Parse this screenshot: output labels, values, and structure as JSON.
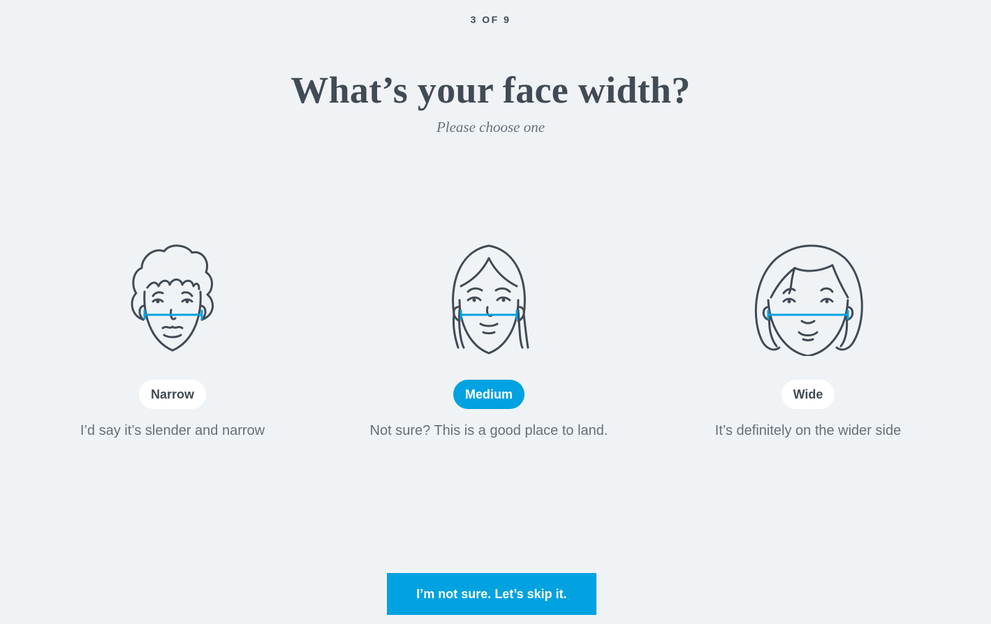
{
  "progress": {
    "label": "3 OF 9",
    "current": 3,
    "total": 9
  },
  "header": {
    "title": "What’s your face width?",
    "subtitle": "Please choose one"
  },
  "options": [
    {
      "label": "Narrow",
      "description": "I’d say it’s slender and narrow",
      "selected": false,
      "icon": "narrow-face-icon"
    },
    {
      "label": "Medium",
      "description": "Not sure? This is a good place to land.",
      "selected": true,
      "icon": "medium-face-icon"
    },
    {
      "label": "Wide",
      "description": "It’s definitely on the wider side",
      "selected": false,
      "icon": "wide-face-icon"
    }
  ],
  "skip_button": {
    "label": "I’m not sure. Let’s skip it."
  },
  "colors": {
    "accent": "#00a2e1",
    "background": "#f0f3f6",
    "text": "#414b56"
  }
}
